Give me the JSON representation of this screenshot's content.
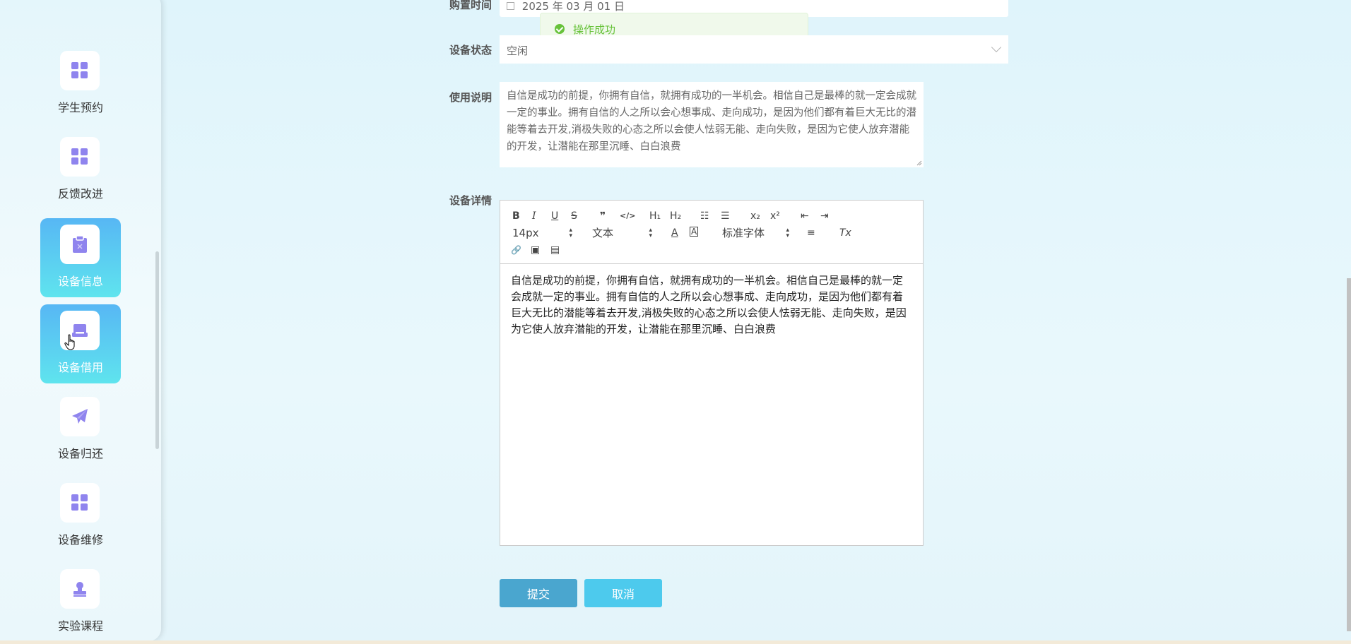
{
  "sidebar": {
    "items": [
      {
        "label": "学生预约",
        "icon": "grid-icon",
        "active": false
      },
      {
        "label": "反馈改进",
        "icon": "grid-icon",
        "active": false
      },
      {
        "label": "设备信息",
        "icon": "clipboard-icon",
        "active": true
      },
      {
        "label": "设备借用",
        "icon": "inbox-icon",
        "active": true
      },
      {
        "label": "设备归还",
        "icon": "paper-plane-icon",
        "active": false
      },
      {
        "label": "设备维修",
        "icon": "grid-icon",
        "active": false
      },
      {
        "label": "实验课程",
        "icon": "stamp-icon",
        "active": false
      }
    ]
  },
  "form": {
    "purchase_date": {
      "label": "购置时间",
      "value": "2025 年 03 月 01 日"
    },
    "status": {
      "label": "设备状态",
      "value": "空闲"
    },
    "usage": {
      "label": "使用说明",
      "value": "自信是成功的前提，你拥有自信，就拥有成功的一半机会。相信自己是最棒的就一定会成就一定的事业。拥有自信的人之所以会心想事成、走向成功，是因为他们都有着巨大无比的潜能等着去开发,消极失败的心态之所以会使人怯弱无能、走向失败，是因为它使人放弃潜能的开发，让潜能在那里沉睡、白白浪费"
    },
    "detail": {
      "label": "设备详情",
      "content": "自信是成功的前提，你拥有自信，就拥有成功的一半机会。相信自己是最棒的就一定会成就一定的事业。拥有自信的人之所以会心想事成、走向成功，是因为他们都有着巨大无比的潜能等着去开发,消极失败的心态之所以会使人怯弱无能、走向失败，是因为它使人放弃潜能的开发，让潜能在那里沉睡、白白浪费"
    }
  },
  "toolbar": {
    "bold": "B",
    "italic": "I",
    "underline": "U",
    "strike": "S",
    "quote": "❞",
    "code": "</>",
    "h1": "H₁",
    "h2": "H₂",
    "ordered_list": "☷",
    "bullet_list": "☰",
    "subscript": "x₂",
    "superscript": "x²",
    "outdent": "⇤",
    "indent": "⇥",
    "size": "14px",
    "header": "文本",
    "color": "A",
    "background": "A",
    "font": "标准字体",
    "align": "≡",
    "clean": "Tx",
    "link": "🔗",
    "image": "▣",
    "video": "▤"
  },
  "toast": {
    "message": "操作成功"
  },
  "buttons": {
    "submit": "提交",
    "cancel": "取消"
  },
  "colors": {
    "accent_purple": "#8f84ee",
    "active_gradient_top": "#57b7f4",
    "active_gradient_bottom": "#5fe4ee",
    "submit_bg": "#4aa6cf",
    "cancel_bg": "#4dcaed",
    "success": "#67c23a"
  }
}
